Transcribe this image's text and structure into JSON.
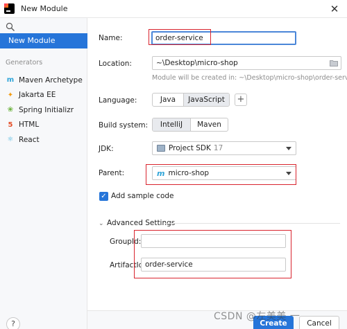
{
  "window": {
    "title": "New Module",
    "close_glyph": "✕"
  },
  "sidebar": {
    "selected_item": "New Module",
    "generators_header": "Generators",
    "generators": [
      {
        "label": "Maven Archetype",
        "icon": "maven-icon",
        "glyph": "m",
        "color": "#2ea4d8"
      },
      {
        "label": "Jakarta EE",
        "icon": "jakarta-icon",
        "glyph": "✦",
        "color": "#f39c12"
      },
      {
        "label": "Spring Initializr",
        "icon": "spring-icon",
        "glyph": "❀",
        "color": "#6db33f"
      },
      {
        "label": "HTML",
        "icon": "html5-icon",
        "glyph": "5",
        "color": "#e44d26"
      },
      {
        "label": "React",
        "icon": "react-icon",
        "glyph": "⚛",
        "color": "#4fb8e0"
      }
    ],
    "help_label": "?"
  },
  "form": {
    "name_label": "Name:",
    "name_value": "order-service",
    "location_label": "Location:",
    "location_value": "~\\Desktop\\micro-shop",
    "location_hint": "Module will be created in: ~\\Desktop\\micro-shop\\order-service",
    "language_label": "Language:",
    "languages": [
      "Java",
      "JavaScript"
    ],
    "add_language": "+",
    "build_label": "Build system:",
    "build_systems": [
      "IntelliJ",
      "Maven"
    ],
    "jdk_label": "JDK:",
    "jdk_value": "Project SDK",
    "jdk_version": "17",
    "parent_label": "Parent:",
    "parent_value": "micro-shop",
    "sample_code_label": "Add sample code",
    "sample_code_checked": true,
    "advanced_label": "Advanced Settings",
    "groupid_label": "GroupId:",
    "groupid_value": "",
    "artifactid_label": "ArtifactId:",
    "artifactid_value": "order-service"
  },
  "footer": {
    "create_label": "Create",
    "cancel_label": "Cancel"
  },
  "watermark": "CSDN @左美美 一",
  "colors": {
    "accent": "#2675d9",
    "highlight": "#d9232d"
  }
}
